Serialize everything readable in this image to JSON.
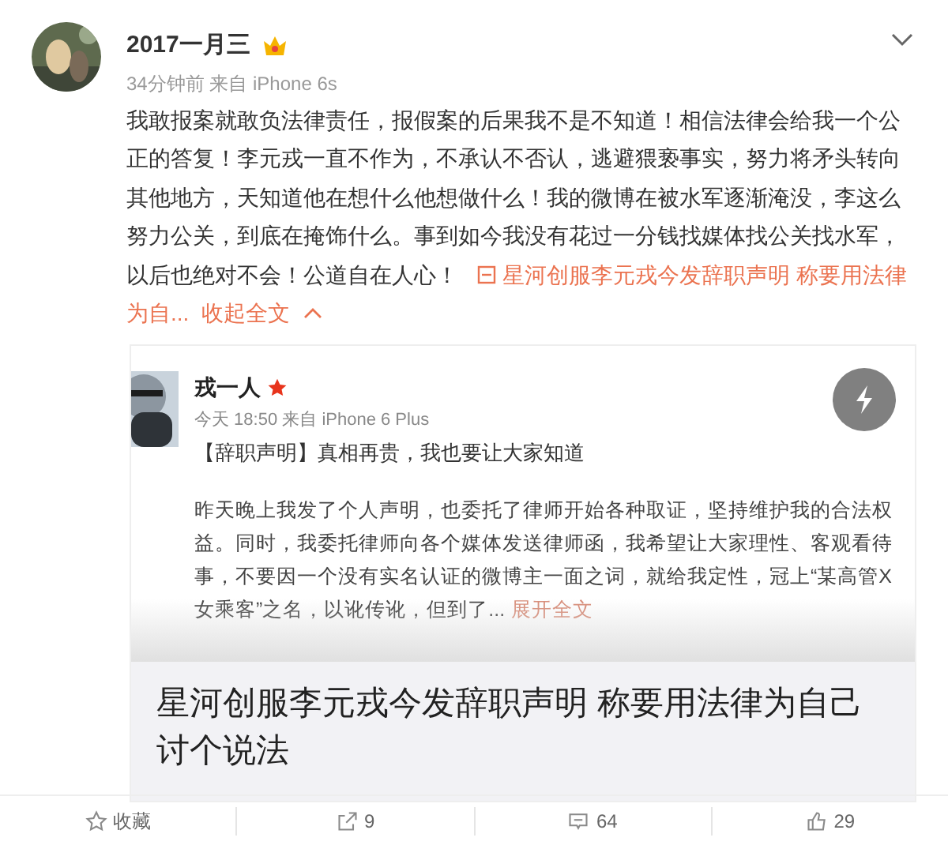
{
  "post": {
    "author": "2017一月三",
    "time_source": "34分钟前 来自 iPhone 6s",
    "body": "我敢报案就敢负法律责任，报假案的后果我不是不知道！相信法律会给我一个公正的答复！李元戎一直不作为，不承认不否认，逃避猥亵事实，努力将矛头转向其他地方，天知道他在想什么他想做什么！我的微博在被水军逐渐淹没，李这么努力公关，到底在掩饰什么。事到如今我没有花过一分钱找媒体找公关找水军，以后也绝对不会！公道自在人心！",
    "article_link_lines": [
      "星河创服李元戎今发辞职声明 称要用法律",
      "为自..."
    ],
    "collapse": "收起全文"
  },
  "card": {
    "author": "戎一人",
    "time_source": "今天 18:50 来自 iPhone 6 Plus",
    "headline": "【辞职声明】真相再贵，我也要让大家知道",
    "excerpt_lines": [
      "昨天晚上我发了个人声明，也委托了律师开始各种取证，坚持维护我的合法权",
      "益。同时，我委托律师向各个媒体发送律师函，我希望让大家理性、客观看待",
      "事，不要因一个没有实名认证的微博主一面之词，就给我定性，冠上“某高管X",
      "女乘客”之名，以讹传讹，但到了..."
    ],
    "expand": "展开全文",
    "title": "星河创服李元戎今发辞职声明 称要用法律为自己讨个说法"
  },
  "actions": [
    {
      "kind": "favorite",
      "label": "收藏"
    },
    {
      "kind": "repost",
      "label": "9"
    },
    {
      "kind": "comment",
      "label": "64"
    },
    {
      "kind": "like",
      "label": "29"
    }
  ]
}
